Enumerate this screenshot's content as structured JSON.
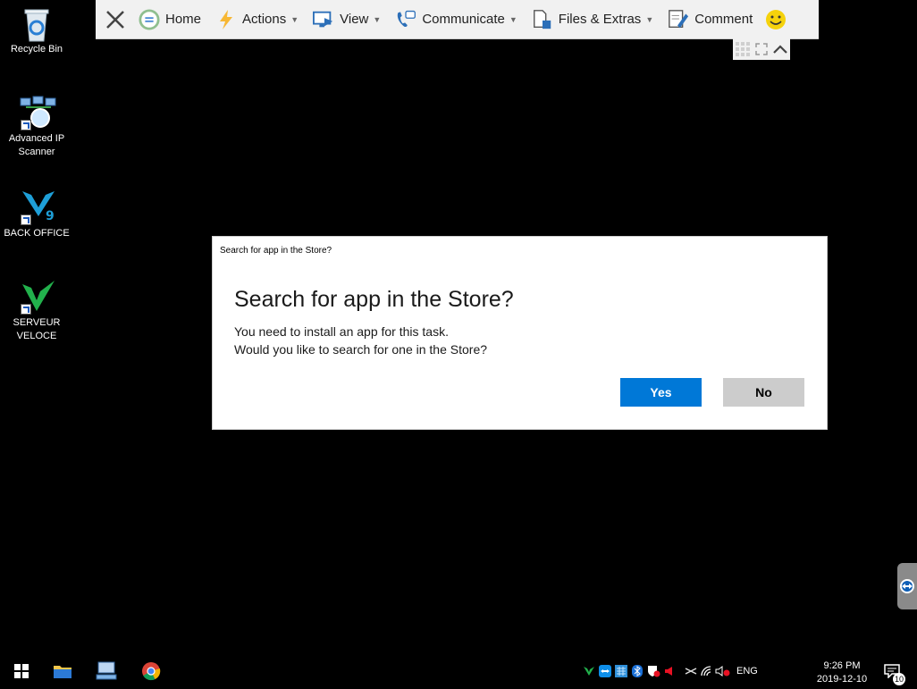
{
  "desktop": {
    "icons": [
      {
        "label": "Recycle Bin"
      },
      {
        "label": "Advanced IP Scanner"
      },
      {
        "label": "BACK OFFICE"
      },
      {
        "label": "SERVEUR VELOCE"
      }
    ]
  },
  "toolbar": {
    "items": [
      {
        "label": "Home"
      },
      {
        "label": "Actions"
      },
      {
        "label": "View"
      },
      {
        "label": "Communicate"
      },
      {
        "label": "Files & Extras"
      },
      {
        "label": "Comment"
      }
    ]
  },
  "dialog": {
    "caption": "Search for app in the Store?",
    "heading": "Search for app in the Store?",
    "message_line1": "You need to install an app for this task.",
    "message_line2": "Would you like to search for one in the Store?",
    "yes_label": "Yes",
    "no_label": "No",
    "accent": "#0078d7"
  },
  "taskbar": {
    "language": "ENG",
    "time": "9:26 PM",
    "date": "2019-12-10",
    "notification_count": "10"
  }
}
